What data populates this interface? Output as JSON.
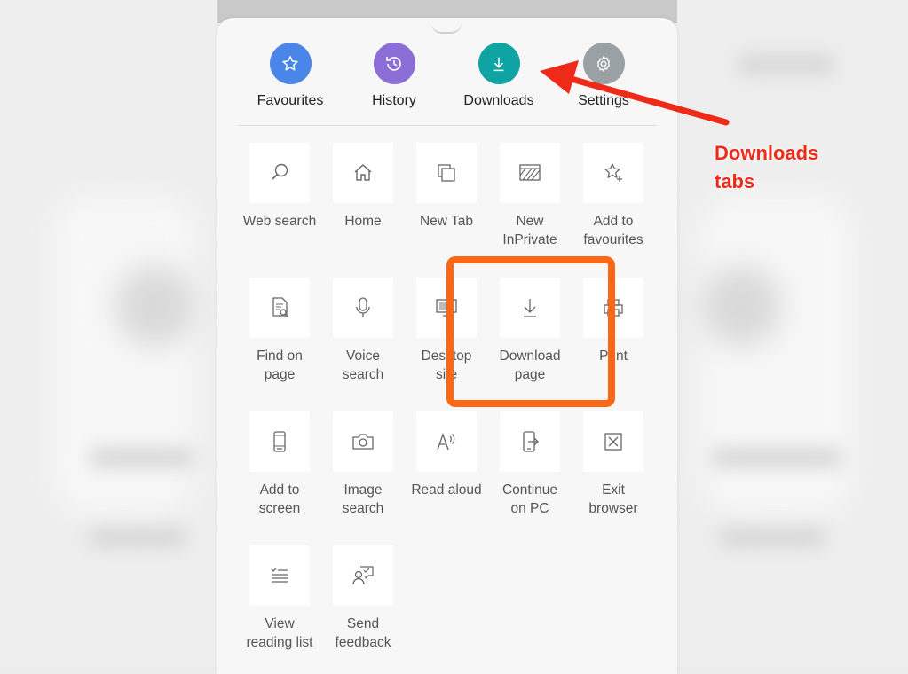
{
  "top_tabs": [
    {
      "label": "Favourites",
      "icon": "star-icon",
      "color": "#4a86e8"
    },
    {
      "label": "History",
      "icon": "history-icon",
      "color": "#8b6fd6"
    },
    {
      "label": "Downloads",
      "icon": "download-icon",
      "color": "#10a3a3"
    },
    {
      "label": "Settings",
      "icon": "gear-icon",
      "color": "#9aa1a5"
    }
  ],
  "menu": {
    "row1": [
      {
        "label": "Web search",
        "icon": "search-icon"
      },
      {
        "label": "Home",
        "icon": "home-icon"
      },
      {
        "label": "New Tab",
        "icon": "new-tab-icon"
      },
      {
        "label": "New InPrivate",
        "icon": "inprivate-icon"
      },
      {
        "label": "Add to favourites",
        "icon": "add-favourite-icon"
      }
    ],
    "row2": [
      {
        "label": "Find on page",
        "icon": "find-icon"
      },
      {
        "label": "Voice search",
        "icon": "microphone-icon"
      },
      {
        "label": "Desktop site",
        "icon": "desktop-icon"
      },
      {
        "label": "Download page",
        "icon": "download-icon"
      },
      {
        "label": "Print",
        "icon": "print-icon"
      }
    ],
    "row3": [
      {
        "label": "Add to screen",
        "icon": "phone-icon"
      },
      {
        "label": "Image search",
        "icon": "camera-icon"
      },
      {
        "label": "Read aloud",
        "icon": "read-aloud-icon"
      },
      {
        "label": "Continue on PC",
        "icon": "continue-pc-icon"
      },
      {
        "label": "Exit browser",
        "icon": "close-icon"
      }
    ],
    "row4": [
      {
        "label": "View reading list",
        "icon": "reading-list-icon"
      },
      {
        "label": "Send feedback",
        "icon": "feedback-icon"
      }
    ]
  },
  "annotation": {
    "line1": "Downloads",
    "line2": "tabs",
    "color": "#ee2b18",
    "box_color": "#fb6714"
  }
}
